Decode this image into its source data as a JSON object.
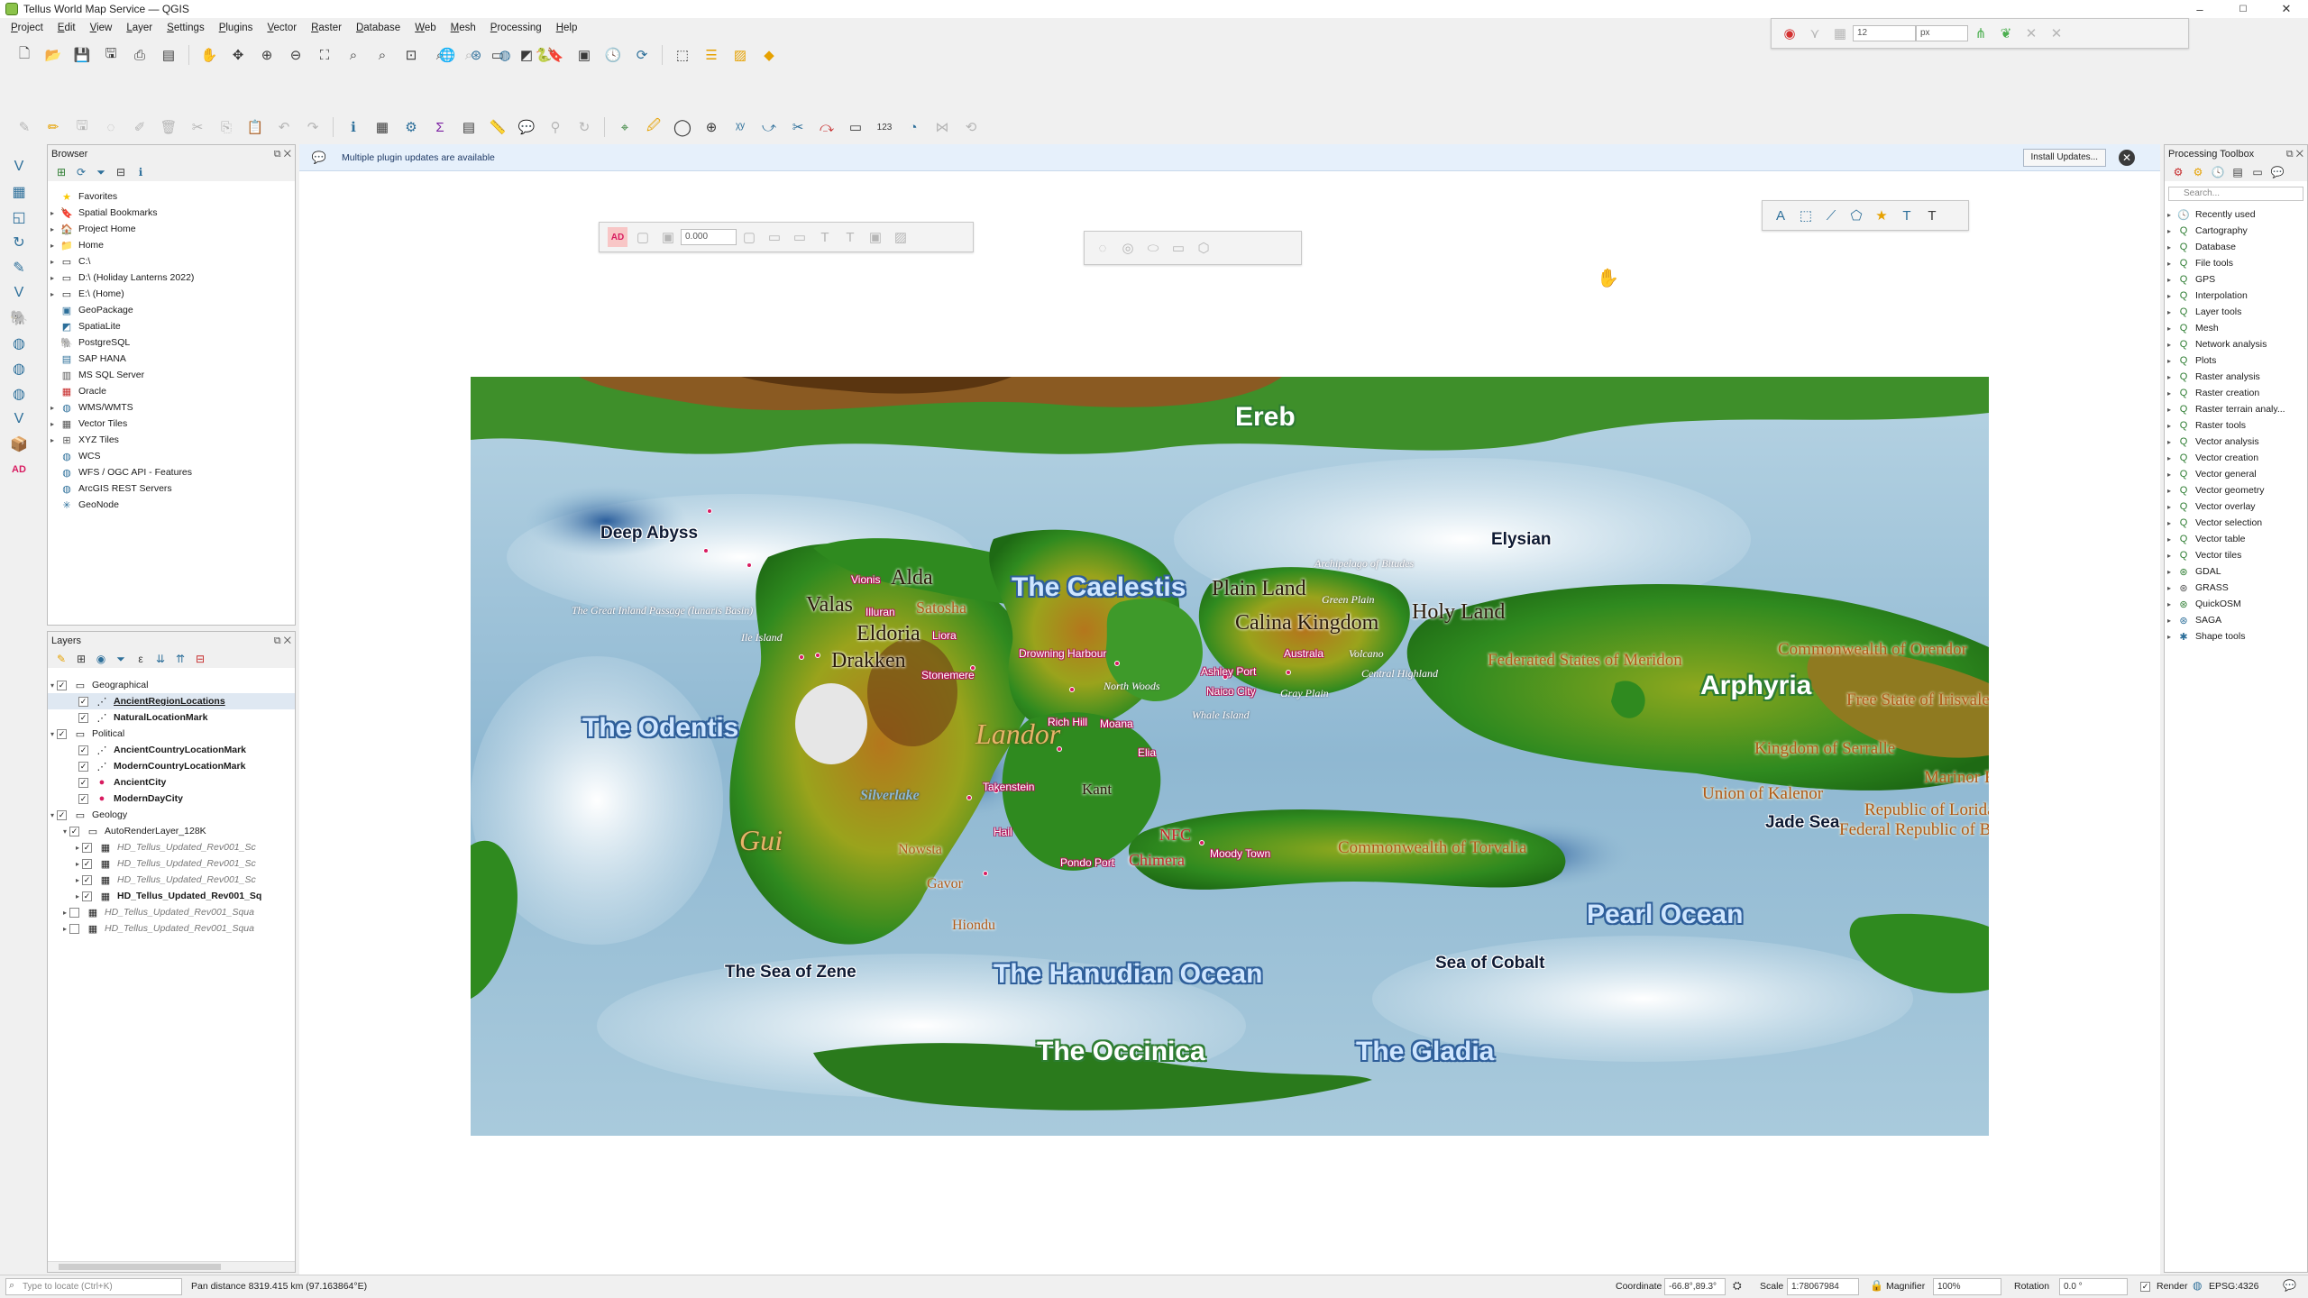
{
  "window": {
    "title": "Tellus World Map Service — QGIS",
    "min": "–",
    "max": "☐",
    "close": "✕"
  },
  "menu": [
    "Project",
    "Edit",
    "View",
    "Layer",
    "Settings",
    "Plugins",
    "Vector",
    "Raster",
    "Database",
    "Web",
    "Mesh",
    "Processing",
    "Help"
  ],
  "snapping": {
    "size": "12",
    "unit": "px"
  },
  "label_toolbar": {
    "value": "0.000",
    "badge": "AD"
  },
  "message_bar": {
    "text": "Multiple plugin updates are available",
    "button": "Install Updates..."
  },
  "browser": {
    "title": "Browser",
    "items": [
      "Favorites",
      "Spatial Bookmarks",
      "Project Home",
      "Home",
      "C:\\",
      "D:\\ (Holiday Lanterns 2022)",
      "E:\\ (Home)",
      "GeoPackage",
      "SpatiaLite",
      "PostgreSQL",
      "SAP HANA",
      "MS SQL Server",
      "Oracle",
      "WMS/WMTS",
      "Vector Tiles",
      "XYZ Tiles",
      "WCS",
      "WFS / OGC API - Features",
      "ArcGIS REST Servers",
      "GeoNode"
    ]
  },
  "layers": {
    "title": "Layers",
    "groups": [
      {
        "name": "Geographical",
        "children": [
          "AncientRegionLocations",
          "NaturalLocationMark"
        ]
      },
      {
        "name": "Political",
        "children": [
          "AncientCountryLocationMark",
          "ModernCountryLocationMark",
          "AncientCity",
          "ModernDayCity"
        ]
      },
      {
        "name": "Geology",
        "children": [
          "AutoRenderLayer_128K"
        ]
      }
    ],
    "rasters": [
      "HD_Tellus_Updated_Rev001_Sc",
      "HD_Tellus_Updated_Rev001_Sc",
      "HD_Tellus_Updated_Rev001_Sc",
      "HD_Tellus_Updated_Rev001_Sq",
      "HD_Tellus_Updated_Rev001_Squa",
      "HD_Tellus_Updated_Rev001_Squa"
    ]
  },
  "processing": {
    "title": "Processing Toolbox",
    "search_placeholder": "Search...",
    "items": [
      "Recently used",
      "Cartography",
      "Database",
      "File tools",
      "GPS",
      "Interpolation",
      "Layer tools",
      "Mesh",
      "Network analysis",
      "Plots",
      "Raster analysis",
      "Raster creation",
      "Raster terrain analy...",
      "Raster tools",
      "Vector analysis",
      "Vector creation",
      "Vector general",
      "Vector geometry",
      "Vector overlay",
      "Vector selection",
      "Vector table",
      "Vector tiles",
      "GDAL",
      "GRASS",
      "QuickOSM",
      "SAGA",
      "Shape tools"
    ]
  },
  "map_labels": {
    "ereb": "Ereb",
    "deep_abyss": "Deep Abyss",
    "elysian": "Elysian",
    "caelestis": "The Caelestis",
    "odentis": "The Odentis",
    "arphyria": "Arphyria",
    "hanudian": "The Hanudian Ocean",
    "pearl": "Pearl Ocean",
    "occinica": "The Occinica",
    "gladia": "The Gladia",
    "sea_zene": "The Sea of Zene",
    "sea_cobalt": "Sea of Cobalt",
    "jade_sea": "Jade Sea",
    "alda": "Alda",
    "valas": "Valas",
    "satosha": "Satosha",
    "eldoria": "Eldoria",
    "drakken": "Drakken",
    "plain_land": "Plain Land",
    "calina": "Calina Kingdom",
    "holy_land": "Holy Land",
    "landor": "Landor",
    "gui": "Gui",
    "inland_passage": "The Great Inland Passage (lunaris Basin)",
    "ile_island": "Ile Island",
    "archipelago": "Archipelago of Bitudes",
    "green_plain": "Green Plain",
    "volcano": "Volcano",
    "central_highland": "Central Highland",
    "gray_plain": "Gray Plain",
    "whale_island": "Whale Island",
    "north_woods": "North Woods",
    "drowning_harbour": "Drowning Harbour",
    "vionis": "Vionis",
    "illuran": "Illuran",
    "liora": "Liora",
    "stonemere": "Stonemere",
    "ashley_port": "Ashley Port",
    "naico_city": "Naico City",
    "australa": "Australa",
    "rich_hill": "Rich Hill",
    "moana": "Moana",
    "elia": "Elia",
    "kant": "Kant",
    "takenstein": "Takenstein",
    "nowsta": "Nowsta",
    "gavor": "Gavor",
    "hiondu": "Hiondu",
    "hail": "Hail",
    "pondo_port": "Pondo Port",
    "nfc": "NFC",
    "chimera": "Chimera",
    "moody_town": "Moody Town",
    "silverlake": "Silverlake",
    "federated": "Federated States of Meridon",
    "orendor": "Commonwealth of Orendor",
    "free_state": "Free State of Irisvale",
    "serralle": "Kingdom of Serralle",
    "kalenor": "Union of Kalenor",
    "marinor": "Marinor Republic",
    "loridan": "Republic of Loridan",
    "bremont": "Federal Republic of Bremont",
    "torvalia": "Commonwealth of Torvalia"
  },
  "status": {
    "locate_placeholder": "Type to locate (Ctrl+K)",
    "message": "Pan distance 8319.415 km (97.163864°E)",
    "coordinate_label": "Coordinate",
    "coordinate": "-66.8°,89.3°",
    "scale_label": "Scale",
    "scale": "1:78067984",
    "magnifier_label": "Magnifier",
    "magnifier": "100%",
    "rotation_label": "Rotation",
    "rotation": "0.0 °",
    "render_label": "Render",
    "crs": "EPSG:4326"
  },
  "colors": {
    "accent": "#2d6f9a",
    "message_bg": "#e6f0fb",
    "city_dot": "#d81b60"
  }
}
